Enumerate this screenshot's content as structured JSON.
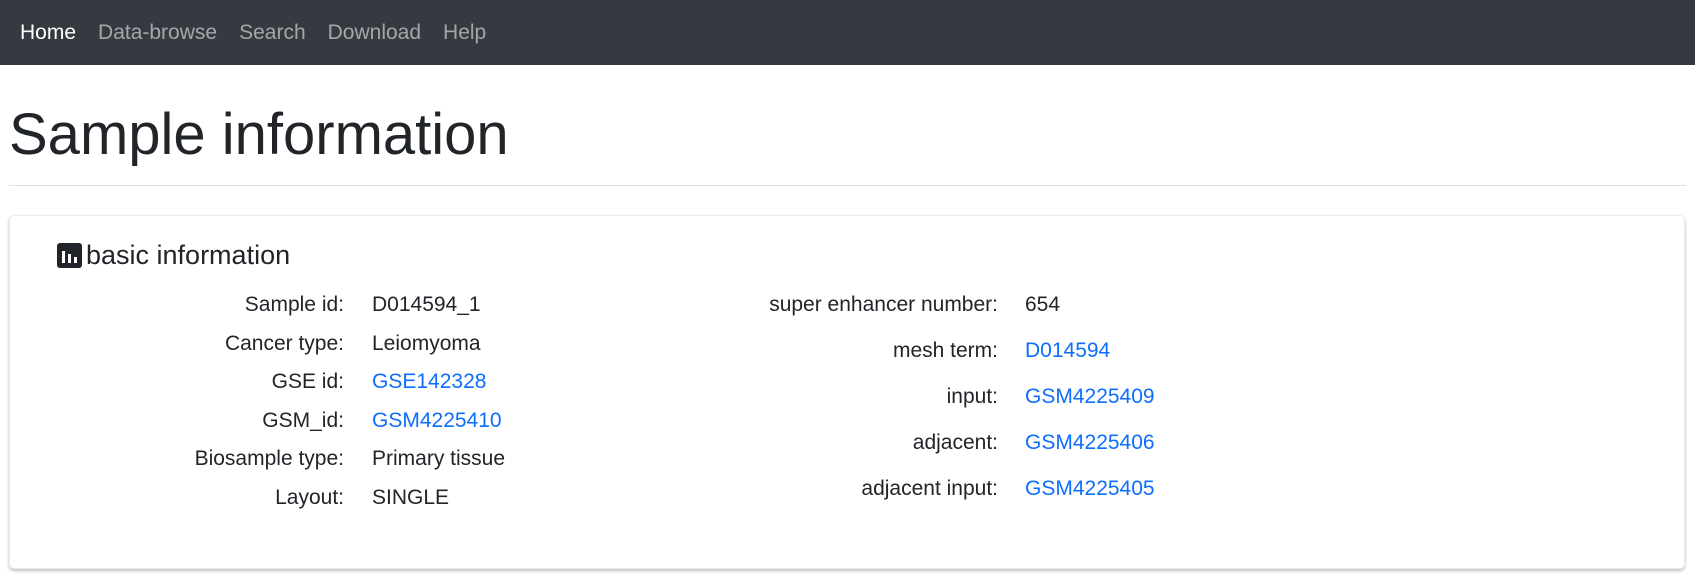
{
  "nav": {
    "items": [
      {
        "label": "Home"
      },
      {
        "label": "Data-browse"
      },
      {
        "label": "Search"
      },
      {
        "label": "Download"
      },
      {
        "label": "Help"
      }
    ]
  },
  "page": {
    "title": "Sample information"
  },
  "card": {
    "icon": "bar-chart-icon",
    "title": "basic information",
    "left_fields": [
      {
        "label": "Sample id:",
        "value": "D014594_1",
        "is_link": false
      },
      {
        "label": "Cancer type:",
        "value": "Leiomyoma",
        "is_link": false
      },
      {
        "label": "GSE id:",
        "value": "GSE142328",
        "is_link": true
      },
      {
        "label": "GSM_id:",
        "value": "GSM4225410",
        "is_link": true
      },
      {
        "label": "Biosample type:",
        "value": "Primary tissue",
        "is_link": false
      },
      {
        "label": "Layout:",
        "value": "SINGLE",
        "is_link": false
      }
    ],
    "right_fields": [
      {
        "label": "super enhancer number:",
        "value": "654",
        "is_link": false
      },
      {
        "label": "mesh term:",
        "value": "D014594",
        "is_link": true
      },
      {
        "label": "input:",
        "value": "GSM4225409",
        "is_link": true
      },
      {
        "label": "adjacent:",
        "value": "GSM4225406",
        "is_link": true
      },
      {
        "label": "adjacent input:",
        "value": "GSM4225405",
        "is_link": true
      }
    ]
  },
  "colors": {
    "navbar_bg": "#343a40",
    "link": "#0d6efd",
    "text": "#212529"
  }
}
